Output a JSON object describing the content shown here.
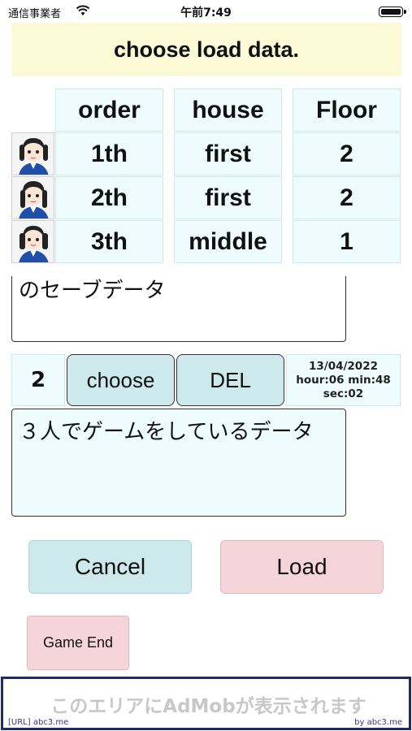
{
  "status_bar": {
    "carrier": "通信事業者",
    "time": "午前7:49"
  },
  "title": "choose load data.",
  "table": {
    "headers": [
      "order",
      "house",
      "Floor"
    ],
    "rows": [
      {
        "order": "1th",
        "house": "first",
        "floor": "2"
      },
      {
        "order": "2th",
        "house": "first",
        "floor": "2"
      },
      {
        "order": "3th",
        "house": "middle",
        "floor": "1"
      }
    ]
  },
  "prev_slot": {
    "comment": "のセーブデータ"
  },
  "slot": {
    "number": "2",
    "choose_label": "choose",
    "del_label": "DEL",
    "date": "13/04/2022",
    "time_line": "hour:06 min:48",
    "sec_line": "sec:02",
    "comment": "３人でゲームをしているデータ"
  },
  "buttons": {
    "cancel": "Cancel",
    "load": "Load",
    "game_end": "Game End"
  },
  "ad": {
    "text": "このエリアにAdMobが表示されます",
    "url": "[URL] abc3.me",
    "by": "by abc3.me"
  },
  "colors": {
    "banner": "#fcf9d6",
    "cell": "#eefcfd",
    "cancel": "#cde9ec",
    "load": "#f6d5da",
    "ad_border": "#1e2a6b"
  }
}
